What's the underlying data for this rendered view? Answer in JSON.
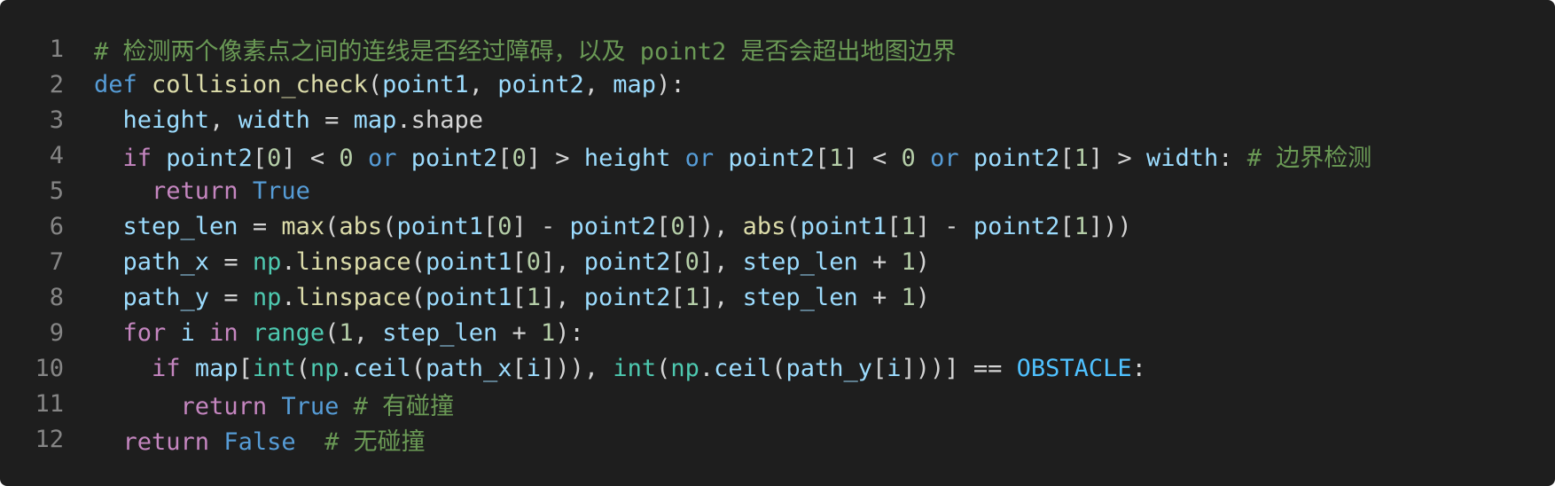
{
  "editor": {
    "background": "#1e1e1e",
    "lines": [
      {
        "number": "1",
        "indent": "",
        "tokens": [
          {
            "t": "# 检测两个像素点之间的连线是否经过障碍，以及 point2 是否会超出地图边界",
            "c": "cm"
          }
        ]
      },
      {
        "number": "2",
        "indent": "",
        "tokens": [
          {
            "t": "def",
            "c": "kw"
          },
          {
            "t": " ",
            "c": "op"
          },
          {
            "t": "collision_check",
            "c": "fn"
          },
          {
            "t": "(",
            "c": "op"
          },
          {
            "t": "point1",
            "c": "var"
          },
          {
            "t": ", ",
            "c": "op"
          },
          {
            "t": "point2",
            "c": "var"
          },
          {
            "t": ", ",
            "c": "op"
          },
          {
            "t": "map",
            "c": "var"
          },
          {
            "t": "):",
            "c": "op"
          }
        ]
      },
      {
        "number": "3",
        "indent": "  ",
        "tokens": [
          {
            "t": "height",
            "c": "var"
          },
          {
            "t": ", ",
            "c": "op"
          },
          {
            "t": "width",
            "c": "var"
          },
          {
            "t": " = ",
            "c": "op"
          },
          {
            "t": "map",
            "c": "var"
          },
          {
            "t": ".shape",
            "c": "op"
          }
        ]
      },
      {
        "number": "4",
        "indent": "  ",
        "tokens": [
          {
            "t": "if",
            "c": "kc"
          },
          {
            "t": " ",
            "c": "op"
          },
          {
            "t": "point2",
            "c": "var"
          },
          {
            "t": "[",
            "c": "op"
          },
          {
            "t": "0",
            "c": "num"
          },
          {
            "t": "] < ",
            "c": "op"
          },
          {
            "t": "0",
            "c": "num"
          },
          {
            "t": " ",
            "c": "op"
          },
          {
            "t": "or",
            "c": "kw"
          },
          {
            "t": " ",
            "c": "op"
          },
          {
            "t": "point2",
            "c": "var"
          },
          {
            "t": "[",
            "c": "op"
          },
          {
            "t": "0",
            "c": "num"
          },
          {
            "t": "] > ",
            "c": "op"
          },
          {
            "t": "height",
            "c": "var"
          },
          {
            "t": " ",
            "c": "op"
          },
          {
            "t": "or",
            "c": "kw"
          },
          {
            "t": " ",
            "c": "op"
          },
          {
            "t": "point2",
            "c": "var"
          },
          {
            "t": "[",
            "c": "op"
          },
          {
            "t": "1",
            "c": "num"
          },
          {
            "t": "] < ",
            "c": "op"
          },
          {
            "t": "0",
            "c": "num"
          },
          {
            "t": " ",
            "c": "op"
          },
          {
            "t": "or",
            "c": "kw"
          },
          {
            "t": " ",
            "c": "op"
          },
          {
            "t": "point2",
            "c": "var"
          },
          {
            "t": "[",
            "c": "op"
          },
          {
            "t": "1",
            "c": "num"
          },
          {
            "t": "] > ",
            "c": "op"
          },
          {
            "t": "width",
            "c": "var"
          },
          {
            "t": ": ",
            "c": "op"
          },
          {
            "t": "# 边界检测",
            "c": "cm"
          }
        ]
      },
      {
        "number": "5",
        "indent": "    ",
        "tokens": [
          {
            "t": "return",
            "c": "kc"
          },
          {
            "t": " ",
            "c": "op"
          },
          {
            "t": "True",
            "c": "kw"
          }
        ]
      },
      {
        "number": "6",
        "indent": "  ",
        "tokens": [
          {
            "t": "step_len",
            "c": "var"
          },
          {
            "t": " = ",
            "c": "op"
          },
          {
            "t": "max",
            "c": "fn"
          },
          {
            "t": "(",
            "c": "op"
          },
          {
            "t": "abs",
            "c": "fn"
          },
          {
            "t": "(",
            "c": "op"
          },
          {
            "t": "point1",
            "c": "var"
          },
          {
            "t": "[",
            "c": "op"
          },
          {
            "t": "0",
            "c": "num"
          },
          {
            "t": "] - ",
            "c": "op"
          },
          {
            "t": "point2",
            "c": "var"
          },
          {
            "t": "[",
            "c": "op"
          },
          {
            "t": "0",
            "c": "num"
          },
          {
            "t": "]), ",
            "c": "op"
          },
          {
            "t": "abs",
            "c": "fn"
          },
          {
            "t": "(",
            "c": "op"
          },
          {
            "t": "point1",
            "c": "var"
          },
          {
            "t": "[",
            "c": "op"
          },
          {
            "t": "1",
            "c": "num"
          },
          {
            "t": "] - ",
            "c": "op"
          },
          {
            "t": "point2",
            "c": "var"
          },
          {
            "t": "[",
            "c": "op"
          },
          {
            "t": "1",
            "c": "num"
          },
          {
            "t": "]))",
            "c": "op"
          }
        ]
      },
      {
        "number": "7",
        "indent": "  ",
        "tokens": [
          {
            "t": "path_x",
            "c": "var"
          },
          {
            "t": " = ",
            "c": "op"
          },
          {
            "t": "np",
            "c": "mod"
          },
          {
            "t": ".",
            "c": "op"
          },
          {
            "t": "linspace",
            "c": "fn"
          },
          {
            "t": "(",
            "c": "op"
          },
          {
            "t": "point1",
            "c": "var"
          },
          {
            "t": "[",
            "c": "op"
          },
          {
            "t": "0",
            "c": "num"
          },
          {
            "t": "], ",
            "c": "op"
          },
          {
            "t": "point2",
            "c": "var"
          },
          {
            "t": "[",
            "c": "op"
          },
          {
            "t": "0",
            "c": "num"
          },
          {
            "t": "], ",
            "c": "op"
          },
          {
            "t": "step_len",
            "c": "var"
          },
          {
            "t": " + ",
            "c": "op"
          },
          {
            "t": "1",
            "c": "num"
          },
          {
            "t": ")",
            "c": "op"
          }
        ]
      },
      {
        "number": "8",
        "indent": "  ",
        "tokens": [
          {
            "t": "path_y",
            "c": "var"
          },
          {
            "t": " = ",
            "c": "op"
          },
          {
            "t": "np",
            "c": "mod"
          },
          {
            "t": ".",
            "c": "op"
          },
          {
            "t": "linspace",
            "c": "fn"
          },
          {
            "t": "(",
            "c": "op"
          },
          {
            "t": "point1",
            "c": "var"
          },
          {
            "t": "[",
            "c": "op"
          },
          {
            "t": "1",
            "c": "num"
          },
          {
            "t": "], ",
            "c": "op"
          },
          {
            "t": "point2",
            "c": "var"
          },
          {
            "t": "[",
            "c": "op"
          },
          {
            "t": "1",
            "c": "num"
          },
          {
            "t": "], ",
            "c": "op"
          },
          {
            "t": "step_len",
            "c": "var"
          },
          {
            "t": " + ",
            "c": "op"
          },
          {
            "t": "1",
            "c": "num"
          },
          {
            "t": ")",
            "c": "op"
          }
        ]
      },
      {
        "number": "9",
        "indent": "  ",
        "tokens": [
          {
            "t": "for",
            "c": "kc"
          },
          {
            "t": " ",
            "c": "op"
          },
          {
            "t": "i",
            "c": "var"
          },
          {
            "t": " ",
            "c": "op"
          },
          {
            "t": "in",
            "c": "kc"
          },
          {
            "t": " ",
            "c": "op"
          },
          {
            "t": "range",
            "c": "mod"
          },
          {
            "t": "(",
            "c": "op"
          },
          {
            "t": "1",
            "c": "num"
          },
          {
            "t": ", ",
            "c": "op"
          },
          {
            "t": "step_len",
            "c": "var"
          },
          {
            "t": " + ",
            "c": "op"
          },
          {
            "t": "1",
            "c": "num"
          },
          {
            "t": "):",
            "c": "op"
          }
        ]
      },
      {
        "number": "10",
        "indent": "    ",
        "tokens": [
          {
            "t": "if",
            "c": "kc"
          },
          {
            "t": " ",
            "c": "op"
          },
          {
            "t": "map",
            "c": "var"
          },
          {
            "t": "[",
            "c": "op"
          },
          {
            "t": "int",
            "c": "mod"
          },
          {
            "t": "(",
            "c": "op"
          },
          {
            "t": "np",
            "c": "mod"
          },
          {
            "t": ".",
            "c": "op"
          },
          {
            "t": "ceil",
            "c": "var"
          },
          {
            "t": "(",
            "c": "op"
          },
          {
            "t": "path_x",
            "c": "var"
          },
          {
            "t": "[",
            "c": "op"
          },
          {
            "t": "i",
            "c": "var"
          },
          {
            "t": "])), ",
            "c": "op"
          },
          {
            "t": "int",
            "c": "mod"
          },
          {
            "t": "(",
            "c": "op"
          },
          {
            "t": "np",
            "c": "mod"
          },
          {
            "t": ".",
            "c": "op"
          },
          {
            "t": "ceil",
            "c": "var"
          },
          {
            "t": "(",
            "c": "op"
          },
          {
            "t": "path_y",
            "c": "var"
          },
          {
            "t": "[",
            "c": "op"
          },
          {
            "t": "i",
            "c": "var"
          },
          {
            "t": "]))] == ",
            "c": "op"
          },
          {
            "t": "OBSTACLE",
            "c": "cst"
          },
          {
            "t": ":",
            "c": "op"
          }
        ]
      },
      {
        "number": "11",
        "indent": "      ",
        "tokens": [
          {
            "t": "return",
            "c": "kc"
          },
          {
            "t": " ",
            "c": "op"
          },
          {
            "t": "True",
            "c": "kw"
          },
          {
            "t": " ",
            "c": "op"
          },
          {
            "t": "# 有碰撞",
            "c": "cm"
          }
        ]
      },
      {
        "number": "12",
        "indent": "  ",
        "tokens": [
          {
            "t": "return",
            "c": "kc"
          },
          {
            "t": " ",
            "c": "op"
          },
          {
            "t": "False",
            "c": "kw"
          },
          {
            "t": "  ",
            "c": "op"
          },
          {
            "t": "# 无碰撞",
            "c": "cm"
          }
        ]
      }
    ]
  }
}
